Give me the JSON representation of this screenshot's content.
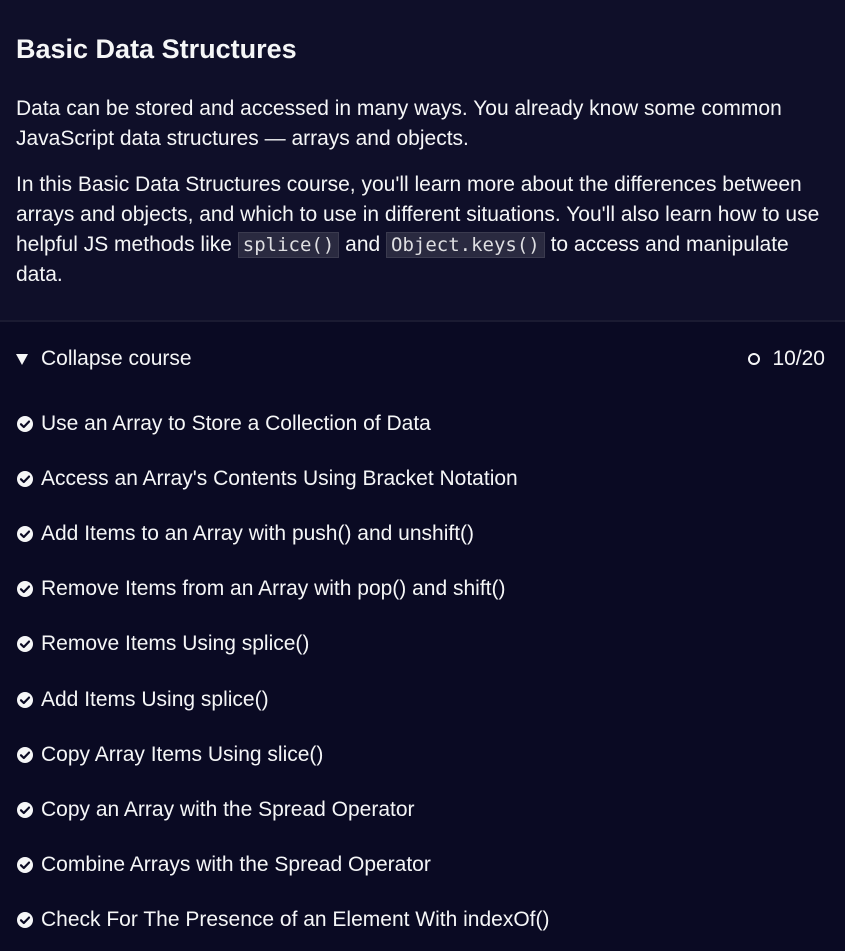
{
  "intro": {
    "title": "Basic Data Structures",
    "paragraph1": "Data can be stored and accessed in many ways. You already know some common JavaScript data structures — arrays and objects.",
    "paragraph2_start": "In this Basic Data Structures course, you'll learn more about the differences between arrays and objects, and which to use in different situations. You'll also learn how to use helpful JS methods like ",
    "code1": "splice()",
    "paragraph2_mid": " and ",
    "code2": "Object.keys()",
    "paragraph2_end": " to access and manipulate data."
  },
  "course_bar": {
    "toggle_label": "Collapse course",
    "toggle_icon": "caret-down-icon",
    "progress_icon": "circle-outline-icon",
    "progress_text": "10/20",
    "completed": 10,
    "total": 20
  },
  "lessons": [
    {
      "title": "Use an Array to Store a Collection of Data",
      "completed": true
    },
    {
      "title": "Access an Array's Contents Using Bracket Notation",
      "completed": true
    },
    {
      "title": "Add Items to an Array with push() and unshift()",
      "completed": true
    },
    {
      "title": "Remove Items from an Array with pop() and shift()",
      "completed": true
    },
    {
      "title": "Remove Items Using splice()",
      "completed": true
    },
    {
      "title": "Add Items Using splice()",
      "completed": true
    },
    {
      "title": "Copy Array Items Using slice()",
      "completed": true
    },
    {
      "title": "Copy an Array with the Spread Operator",
      "completed": true
    },
    {
      "title": "Combine Arrays with the Spread Operator",
      "completed": true
    },
    {
      "title": "Check For The Presence of an Element With indexOf()",
      "completed": true
    }
  ],
  "colors": {
    "background": "#0a0a23",
    "intro_background": "#0f0f29",
    "text": "#f5f6f7",
    "code_background": "#2a2a40"
  }
}
